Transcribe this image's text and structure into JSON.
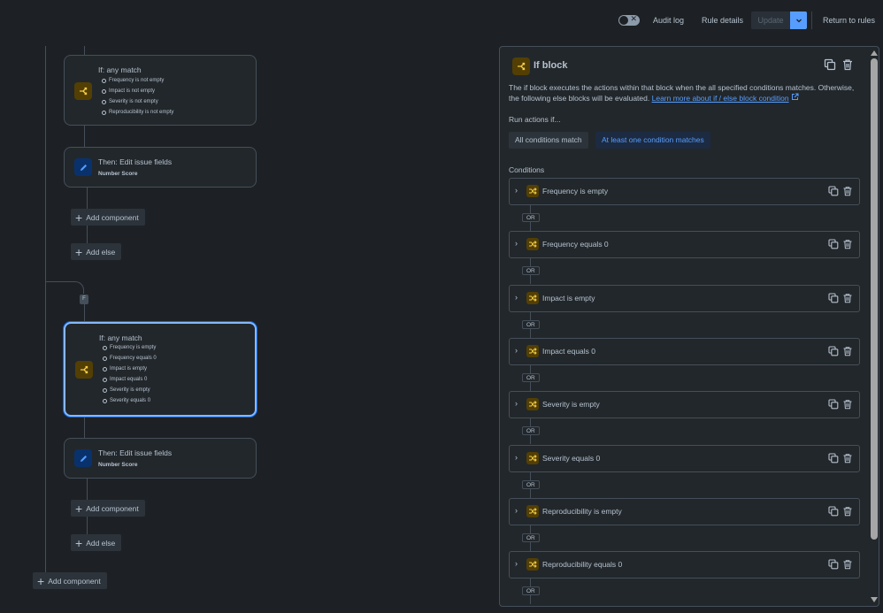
{
  "topbar": {
    "audit_log": "Audit log",
    "rule_details": "Rule details",
    "update": "Update",
    "return": "Return to rules"
  },
  "canvas": {
    "node1": {
      "title": "If: any match",
      "items": [
        "Frequency is not empty",
        "Impact is not empty",
        "Severity is not empty",
        "Reproducibility is not empty"
      ]
    },
    "node2": {
      "title": "Then: Edit issue fields",
      "sub": "Number Score"
    },
    "add_component": "Add component",
    "add_else": "Add else",
    "node3": {
      "title": "If: any match",
      "items": [
        "Frequency is empty",
        "Frequency equals 0",
        "Impact is empty",
        "Impact equals 0",
        "Severity is empty",
        "Severity equals 0"
      ]
    },
    "node4": {
      "title": "Then: Edit issue fields",
      "sub": "Number Score"
    },
    "branch_badge": "F"
  },
  "panel": {
    "title": "If block",
    "description": "The if block executes the actions within that block when the all specified conditions matches. Otherwise, the following else blocks will be evaluated.",
    "learn_more": "Learn more about if / else block condition",
    "run_label": "Run actions if...",
    "option_all": "All conditions match",
    "option_any": "At least one condition matches",
    "conditions_label": "Conditions",
    "or_label": "OR",
    "conditions": [
      "Frequency is empty",
      "Frequency equals 0",
      "Impact is empty",
      "Impact equals 0",
      "Severity is empty",
      "Severity equals 0",
      "Reproducibility is empty",
      "Reproducibility equals 0"
    ]
  },
  "colors": {
    "accent": "#579dff",
    "if_icon_bg": "#533f04",
    "if_icon_fg": "#f5cd47",
    "edit_icon_bg": "#09326c",
    "edit_icon_fg": "#579dff"
  },
  "icons": [
    "branch-icon",
    "pencil-icon",
    "plus-icon",
    "copy-icon",
    "trash-icon",
    "chevron-right-icon",
    "chevron-down-icon",
    "shuffle-icon",
    "external-link-icon"
  ]
}
